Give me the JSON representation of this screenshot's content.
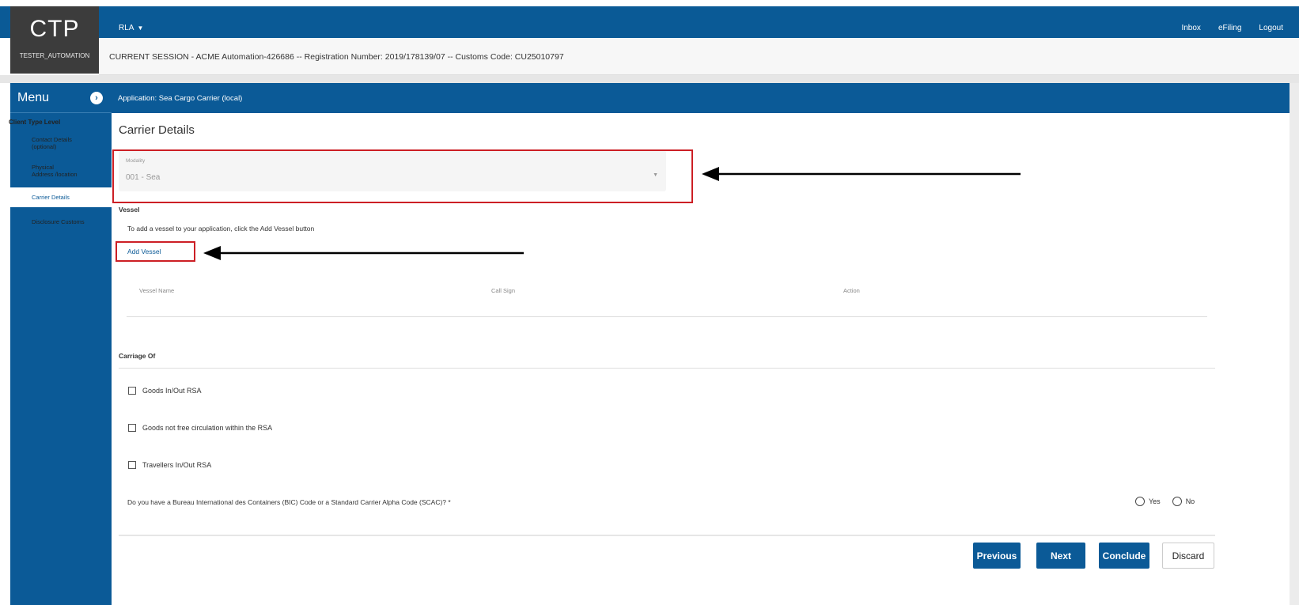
{
  "header": {
    "logo_text": "CTP",
    "username": "TESTER_AUTOMATION",
    "menu_label": "RLA",
    "links": [
      "Inbox",
      "eFiling",
      "Logout"
    ],
    "session_info": "CURRENT SESSION - ACME Automation-426686 -- Registration Number: 2019/178139/07 -- Customs Code: CU25010797"
  },
  "sidebar": {
    "title": "Menu",
    "level_label": "Client Type Level",
    "items": [
      {
        "line1": "Contact Details",
        "line2": "(optional)"
      },
      {
        "line1": "Physical",
        "line2": "Address /location"
      },
      {
        "line1": "Carrier Details",
        "line2": ""
      },
      {
        "line1": "Disclosure Customs",
        "line2": ""
      }
    ]
  },
  "app_bar": {
    "label": "Application: Sea Cargo Carrier (local)"
  },
  "main": {
    "title": "Carrier Details",
    "modality": {
      "label": "Modality",
      "value": "001 - Sea"
    },
    "vessel": {
      "heading": "Vessel",
      "helper": "To add a vessel to your application, click the  Add Vessel  button",
      "add_link": "Add Vessel",
      "columns": [
        "Vessel Name",
        "Call Sign",
        "Action"
      ]
    },
    "carriage": {
      "heading": "Carriage Of",
      "options": [
        "Goods In/Out RSA",
        "Goods not free circulation within the RSA",
        "Travellers In/Out RSA"
      ]
    },
    "bic": {
      "question": "Do you have a Bureau International des Containers (BIC) Code or a Standard Carrier Alpha Code (SCAC)? *",
      "yes_label": "Yes",
      "no_label": "No"
    },
    "buttons": {
      "previous": "Previous",
      "next": "Next",
      "conclude": "Conclude",
      "discard": "Discard"
    }
  },
  "colors": {
    "brand_blue": "#0b5a97",
    "annotation_red": "#cc1f25"
  }
}
